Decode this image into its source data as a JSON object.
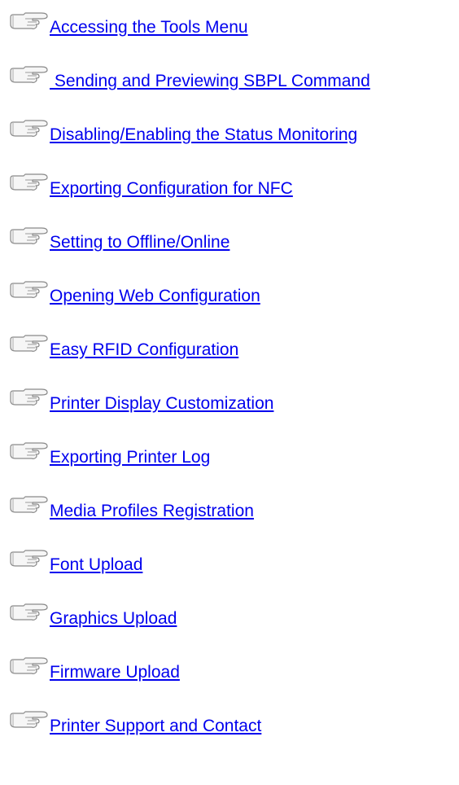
{
  "links": [
    {
      "label": "Accessing the Tools Menu"
    },
    {
      "label": " Sending and Previewing SBPL Command"
    },
    {
      "label": "Disabling/Enabling the Status Monitoring"
    },
    {
      "label": "Exporting Configuration for NFC"
    },
    {
      "label": "Setting to Offline/Online"
    },
    {
      "label": "Opening Web Configuration"
    },
    {
      "label": "Easy RFID Configuration"
    },
    {
      "label": "Printer Display Customization"
    },
    {
      "label": "Exporting Printer Log"
    },
    {
      "label": "Media Profiles Registration"
    },
    {
      "label": "Font Upload"
    },
    {
      "label": "Graphics Upload"
    },
    {
      "label": "Firmware Upload"
    },
    {
      "label": "Printer Support and Contact"
    }
  ],
  "icon": "pointing-hand-icon",
  "colors": {
    "link": "#0000ee",
    "background": "#ffffff"
  }
}
